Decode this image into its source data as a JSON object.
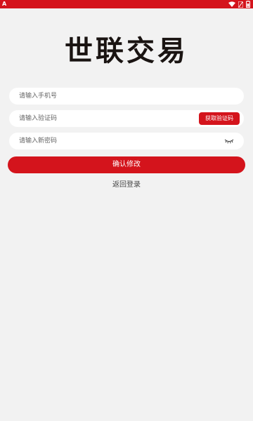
{
  "status_bar": {
    "left_icon": "A",
    "icons": [
      "wifi-icon",
      "no-sim-icon",
      "battery-icon"
    ],
    "color": "#d4141c"
  },
  "logo": {
    "text": "世联交易"
  },
  "form": {
    "phone": {
      "placeholder": "请输入手机号",
      "value": ""
    },
    "code": {
      "placeholder": "请输入验证码",
      "value": "",
      "button_label": "获取验证码"
    },
    "password": {
      "placeholder": "请输入新密码",
      "value": "",
      "toggle_icon": "eye-closed-icon"
    },
    "submit_label": "确认修改"
  },
  "back_link": "返回登录",
  "colors": {
    "accent": "#d4141c",
    "background": "#f2f2f2",
    "field": "#ffffff"
  }
}
